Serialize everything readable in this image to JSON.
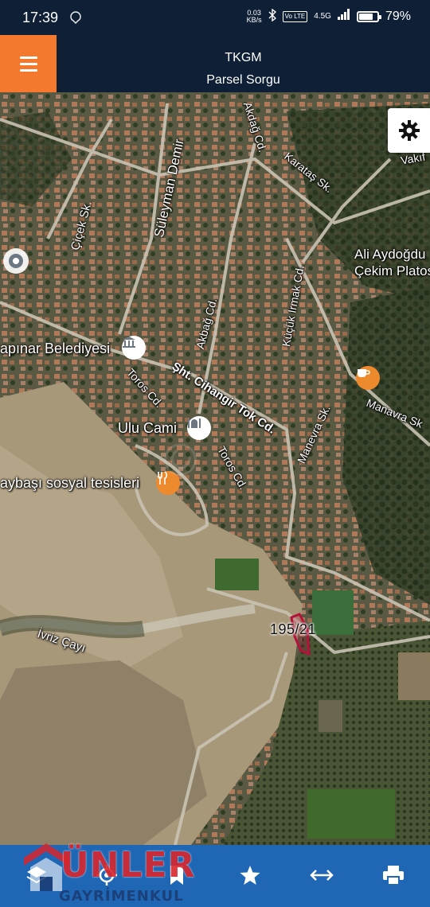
{
  "status_bar": {
    "time": "17:39",
    "net_speed_value": "0.03",
    "net_speed_unit": "KB/s",
    "lte_badge": "Vo LTE",
    "network": "4.5G",
    "battery_percent": "79%",
    "battery_level": 0.79
  },
  "header": {
    "title": "TKGM",
    "subtitle": "Parsel Sorgu",
    "menu_color": "#f4792f",
    "bar_color": "#0f2036"
  },
  "map": {
    "labels": {
      "suleyman": "Süleyman Demir",
      "akdag_top": "Akdağ Cd.",
      "karatas": "Karataş Sk.",
      "vakif": "Vakıf",
      "cicek": "Çiçek Sk.",
      "ali": "Ali Aydoğdu",
      "cekim": "Çekim Platosu",
      "kucuk_irmak": "Küçük Irmak Cd.",
      "akbag": "Akbağ Cd.",
      "belediye": "apınar Belediyesi",
      "cihangir": "Şht. Cihangir Tok Cd.",
      "toros1": "Toros Cd.",
      "toros2": "Toros Cd.",
      "manevra_sk": "Manevra Sk.",
      "manavra_sk": "Manavra Sk",
      "ulu_cami": "Ulu Cami",
      "sosyal": "aybaşı sosyal tesisleri",
      "ivriz": "İvriz Çayı"
    },
    "parcel_number": "195/21",
    "parcel_color": "#b3123a"
  },
  "toolbar": {
    "buttons": [
      "layers-icon",
      "locate-icon",
      "bookmark-icon",
      "star-icon",
      "measure-icon",
      "print-icon"
    ],
    "color": "#1f67b5"
  },
  "watermark": {
    "line1": "ÜNLER",
    "line2": "GAYRİMENKUL"
  }
}
